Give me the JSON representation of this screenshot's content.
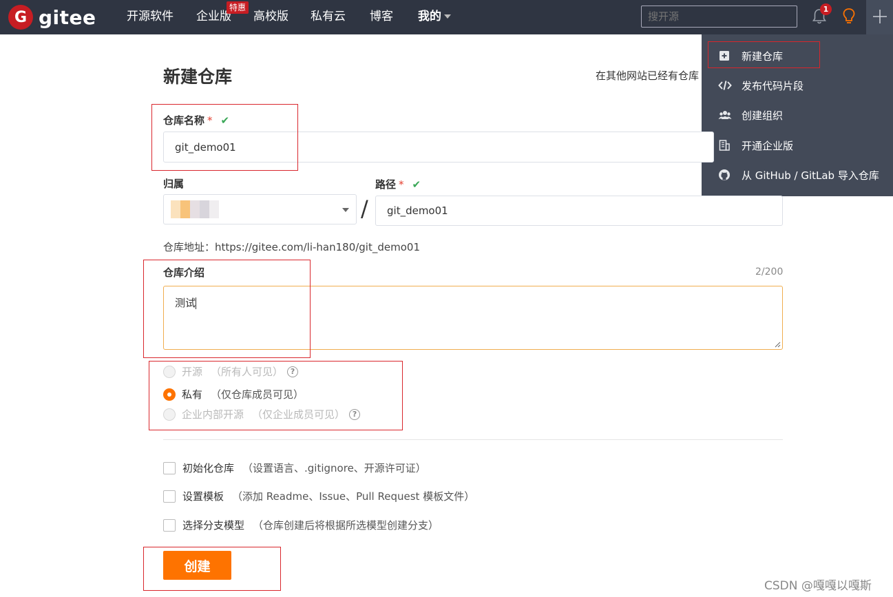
{
  "navbar": {
    "logo_mark": "G",
    "logo_text": "gitee",
    "items": [
      {
        "label": "开源软件"
      },
      {
        "label": "企业版"
      },
      {
        "label": "高校版"
      },
      {
        "label": "私有云"
      },
      {
        "label": "博客"
      },
      {
        "label": "我的"
      }
    ],
    "promo_badge": "特惠",
    "search_placeholder": "搜开源",
    "notification_count": "1"
  },
  "dropdown": {
    "items": [
      {
        "label": "新建仓库",
        "icon": "plus-square-icon"
      },
      {
        "label": "发布代码片段",
        "icon": "code-icon"
      },
      {
        "label": "创建组织",
        "icon": "users-icon"
      },
      {
        "label": "开通企业版",
        "icon": "building-icon"
      },
      {
        "label": "从 GitHub / GitLab 导入仓库",
        "icon": "github-icon"
      }
    ]
  },
  "form": {
    "title": "新建仓库",
    "import_hint": "在其他网站已经有仓库",
    "repo_name": {
      "label": "仓库名称",
      "required": "*",
      "value": "git_demo01"
    },
    "owner": {
      "label": "归属"
    },
    "path": {
      "label": "路径",
      "required": "*",
      "value": "git_demo01"
    },
    "slash": "/",
    "repo_url": "仓库地址：https://gitee.com/li-han180/git_demo01",
    "description": {
      "label": "仓库介绍",
      "counter": "2/200",
      "value": "测试"
    },
    "visibility": [
      {
        "label": "开源",
        "note": "（所有人可见）",
        "selected": false,
        "disabled": true,
        "help": "?"
      },
      {
        "label": "私有",
        "note": "（仅仓库成员可见）",
        "selected": true,
        "disabled": false
      },
      {
        "label": "企业内部开源",
        "note": "（仅企业成员可见）",
        "selected": false,
        "disabled": true,
        "help": "?"
      }
    ],
    "options": [
      {
        "label": "初始化仓库",
        "note": "（设置语言、.gitignore、开源许可证）"
      },
      {
        "label": "设置模板",
        "note": "（添加 Readme、Issue、Pull Request 模板文件）"
      },
      {
        "label": "选择分支模型",
        "note": "（仓库创建后将根据所选模型创建分支）"
      }
    ],
    "submit_label": "创建"
  },
  "watermark": "CSDN @嘎嘎以嘎斯",
  "colors": {
    "navbar": "#2f3542",
    "accent": "#fe7300",
    "brand": "#c71d23",
    "annotation": "#d9262c"
  }
}
